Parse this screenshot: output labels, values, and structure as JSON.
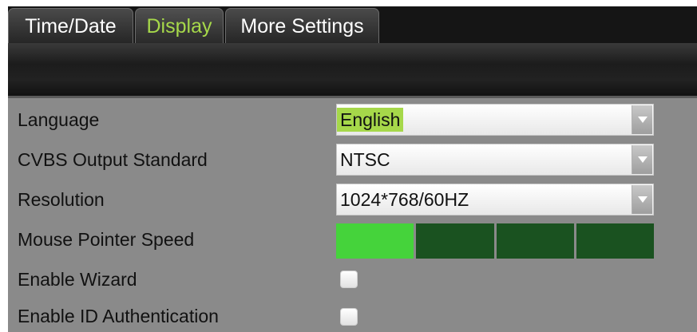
{
  "tabs": [
    {
      "label": "Time/Date",
      "active": false
    },
    {
      "label": "Display",
      "active": true
    },
    {
      "label": "More Settings",
      "active": false
    }
  ],
  "settings": {
    "language": {
      "label": "Language",
      "value": "English"
    },
    "cvbs": {
      "label": "CVBS Output Standard",
      "value": "NTSC"
    },
    "resolution": {
      "label": "Resolution",
      "value": "1024*768/60HZ"
    },
    "mouse_speed": {
      "label": "Mouse Pointer Speed",
      "level": 1,
      "max": 4
    },
    "wizard": {
      "label": "Enable Wizard",
      "checked": false
    },
    "id_auth": {
      "label": "Enable ID Authentication",
      "checked": false
    }
  },
  "colors": {
    "active_tab_text": "#a6d84a",
    "selection_highlight": "#a6d84a",
    "speed_on": "#45d33b",
    "speed_off": "#1a5220",
    "panel_bg": "#8a8a8a"
  },
  "icons": {
    "dropdown": "triangle-down-icon"
  }
}
